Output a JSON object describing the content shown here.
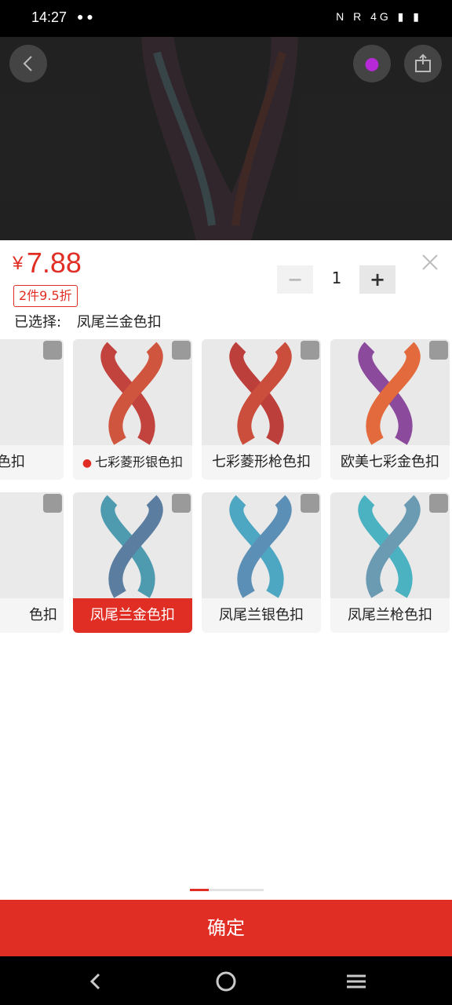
{
  "status_bar": {
    "time": "14:27",
    "left_icons": [
      "chat-bubble",
      "chat-bubble"
    ],
    "right_icons_text": "N R 4G"
  },
  "price": {
    "symbol": "¥",
    "value": "7.88"
  },
  "promo": "2件9.5折",
  "selected": {
    "label": "已选择:",
    "value": "凤尾兰金色扣"
  },
  "quantity": {
    "minus": "−",
    "value": "1",
    "plus": "+"
  },
  "variants_row1": [
    {
      "label": "金色扣",
      "hot": false
    },
    {
      "label": "七彩菱形银色扣",
      "hot": true
    },
    {
      "label": "七彩菱形枪色扣",
      "hot": false
    },
    {
      "label": "欧美七彩金色扣",
      "hot": false
    }
  ],
  "variants_row2": [
    {
      "label": "色扣",
      "hot": false
    },
    {
      "label": "凤尾兰金色扣",
      "hot": false,
      "selected": true
    },
    {
      "label": "凤尾兰银色扣",
      "hot": false
    },
    {
      "label": "凤尾兰枪色扣",
      "hot": false
    }
  ],
  "confirm_label": "确定",
  "colors": {
    "accent": "#e02e24"
  }
}
